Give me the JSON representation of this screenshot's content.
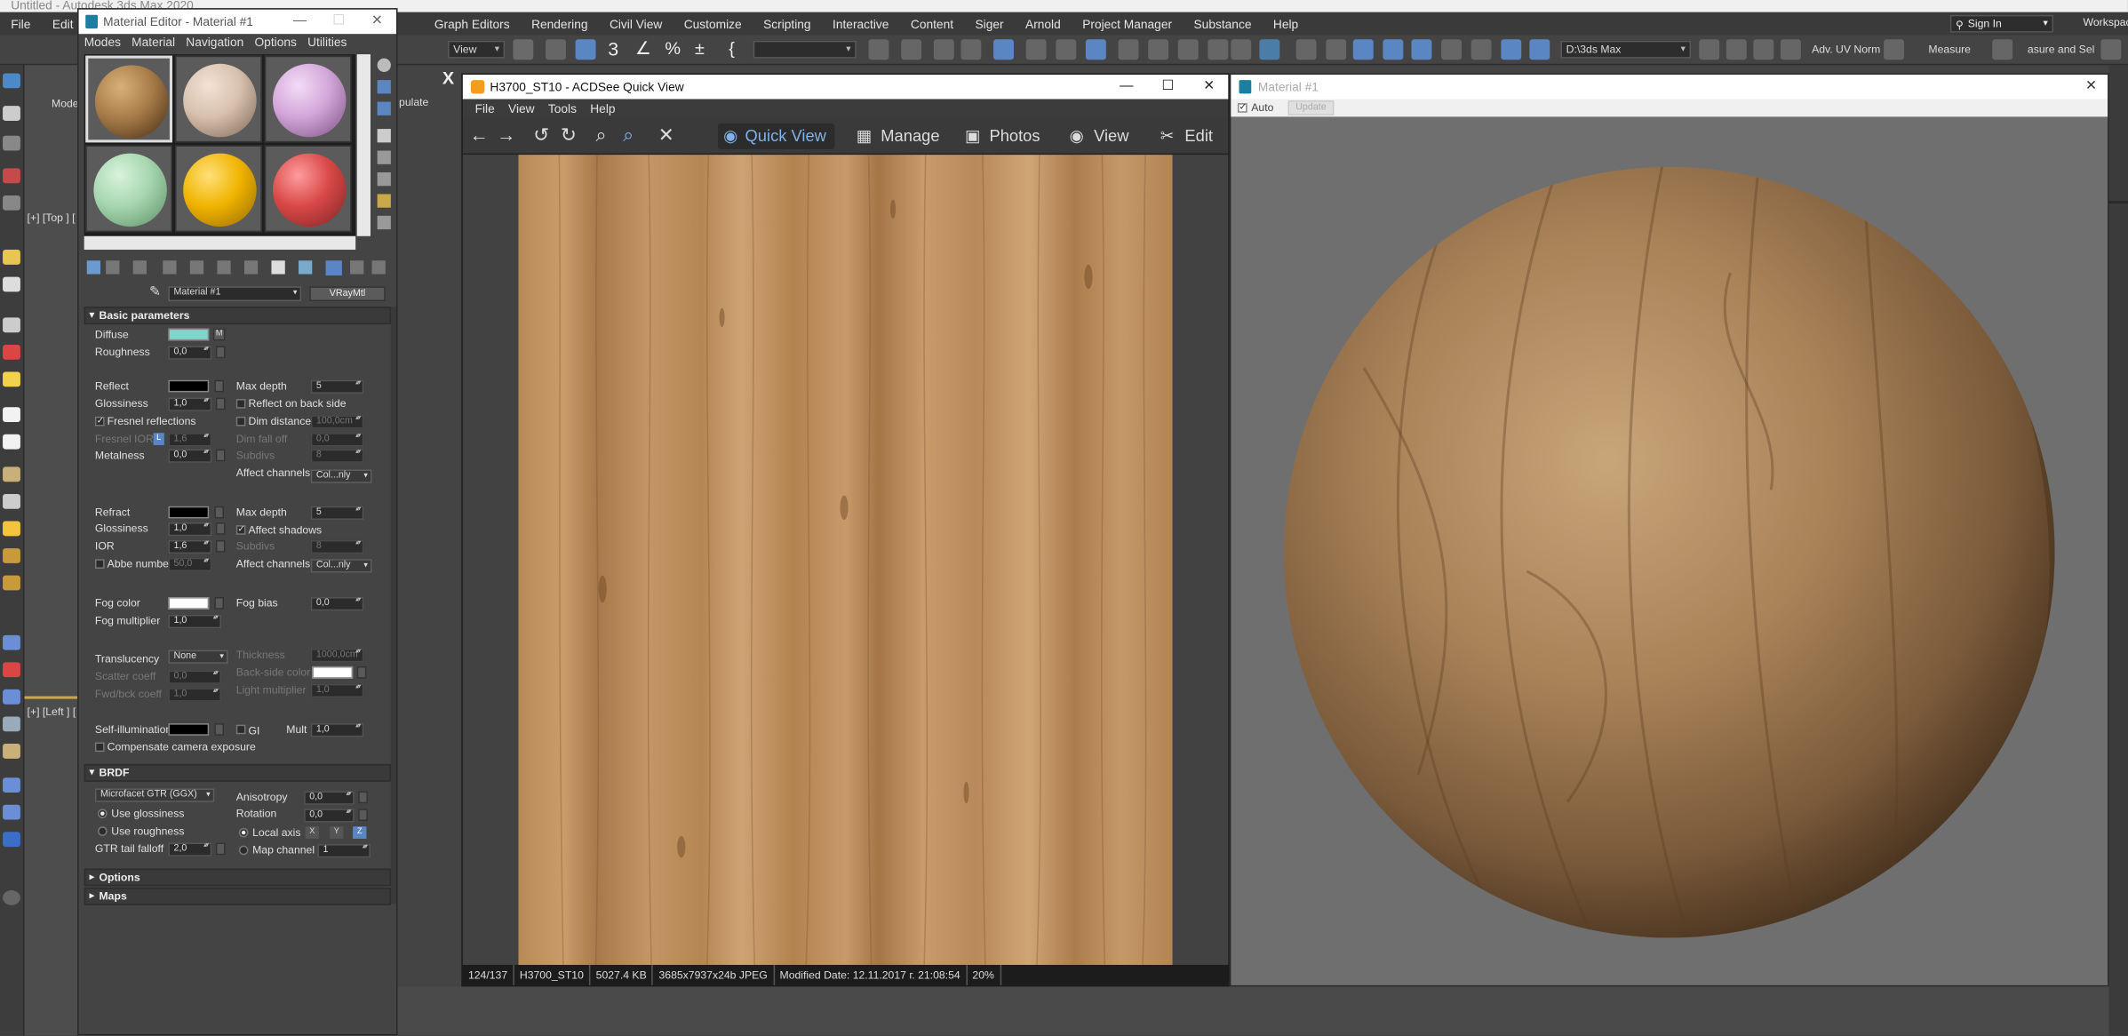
{
  "max": {
    "title": "Untitled - Autodesk 3ds Max 2020",
    "menu": [
      "File",
      "Edit",
      "Graph Editors",
      "Rendering",
      "Civil View",
      "Customize",
      "Scripting",
      "Interactive",
      "Content",
      "Siger",
      "Arnold",
      "Project Manager",
      "Substance",
      "Help"
    ],
    "sign_in": "Sign In",
    "workspace": "Workspace",
    "view_dropdown": "View",
    "path_dropdown": "D:\\3ds Max",
    "adv_uv": "Adv. UV Norm",
    "measure": "Measure",
    "measure_sel": "asure and Sel",
    "cmd_tab": "Mode",
    "cmd_tab2": "pulate",
    "vp_top": "[+] [Top ] [",
    "vp_left": "[+] [Left ] [",
    "x_label": "X"
  },
  "material_editor": {
    "title": "Material Editor - Material #1",
    "menu": [
      "Modes",
      "Material",
      "Navigation",
      "Options",
      "Utilities"
    ],
    "material_name": "Material #1",
    "material_type": "VRayMtl",
    "basic_params": "Basic parameters",
    "diffuse": "Diffuse",
    "diffuse_color": "#7fd6cc",
    "m_label": "M",
    "roughness": "Roughness",
    "roughness_val": "0,0",
    "reflect": "Reflect",
    "glossiness": "Glossiness",
    "refl_gloss_val": "1,0",
    "fresnel": "Fresnel reflections",
    "fresnel_ior": "Fresnel IOR",
    "fresnel_ior_l": "L",
    "fresnel_ior_val": "1,6",
    "metalness": "Metalness",
    "metalness_val": "0,0",
    "max_depth": "Max depth",
    "max_depth_val": "5",
    "reflect_backside": "Reflect on back side",
    "dim_distance": "Dim distance",
    "dim_distance_val": "100,0cm",
    "dim_falloff": "Dim fall off",
    "dim_falloff_val": "0,0",
    "subdivs": "Subdivs",
    "subdivs_val": "8",
    "affect_channels": "Affect channels",
    "affect_channels_val": "Col...nly",
    "refract": "Refract",
    "refr_gloss_val": "1,0",
    "ior": "IOR",
    "ior_val": "1,6",
    "abbe": "Abbe number",
    "abbe_val": "50,0",
    "refr_max_depth_val": "5",
    "affect_shadows": "Affect shadows",
    "fog_color": "Fog color",
    "fog_multiplier": "Fog multiplier",
    "fog_mult_val": "1,0",
    "fog_bias": "Fog bias",
    "fog_bias_val": "0,0",
    "translucency": "Translucency",
    "translucency_val": "None",
    "scatter_coeff": "Scatter coeff",
    "scatter_val": "0,0",
    "fwd_bck": "Fwd/bck coeff",
    "fwd_bck_val": "1,0",
    "thickness": "Thickness",
    "thickness_val": "1000,0cm",
    "backside_color": "Back-side color",
    "light_multiplier": "Light multiplier",
    "light_mult_val": "1,0",
    "self_illum": "Self-illumination",
    "gi": "GI",
    "mult": "Mult",
    "mult_val": "1,0",
    "compensate": "Compensate camera exposure",
    "brdf": "BRDF",
    "brdf_type": "Microfacet GTR (GGX)",
    "use_glossiness": "Use glossiness",
    "use_roughness": "Use roughness",
    "gtr_tail": "GTR tail falloff",
    "gtr_tail_val": "2,0",
    "anisotropy": "Anisotropy",
    "anisotropy_val": "0,0",
    "rotation": "Rotation",
    "rotation_val": "0,0",
    "local_axis": "Local axis",
    "axis_x": "X",
    "axis_y": "Y",
    "axis_z": "Z",
    "map_channel": "Map channel",
    "map_channel_val": "1",
    "options": "Options",
    "maps": "Maps"
  },
  "acdsee": {
    "title": "H3700_ST10 - ACDSee Quick View",
    "menu": [
      "File",
      "View",
      "Tools",
      "Help"
    ],
    "tabs": [
      "Quick View",
      "Manage",
      "Photos",
      "View",
      "Edit"
    ],
    "status": [
      "124/137",
      "H3700_ST10",
      "5027.4 KB",
      "3685x7937x24b JPEG",
      "Modified Date: 12.11.2017 г. 21:08:54",
      "20%"
    ]
  },
  "preview": {
    "title": "Material #1",
    "auto": "Auto",
    "update": "Update"
  }
}
